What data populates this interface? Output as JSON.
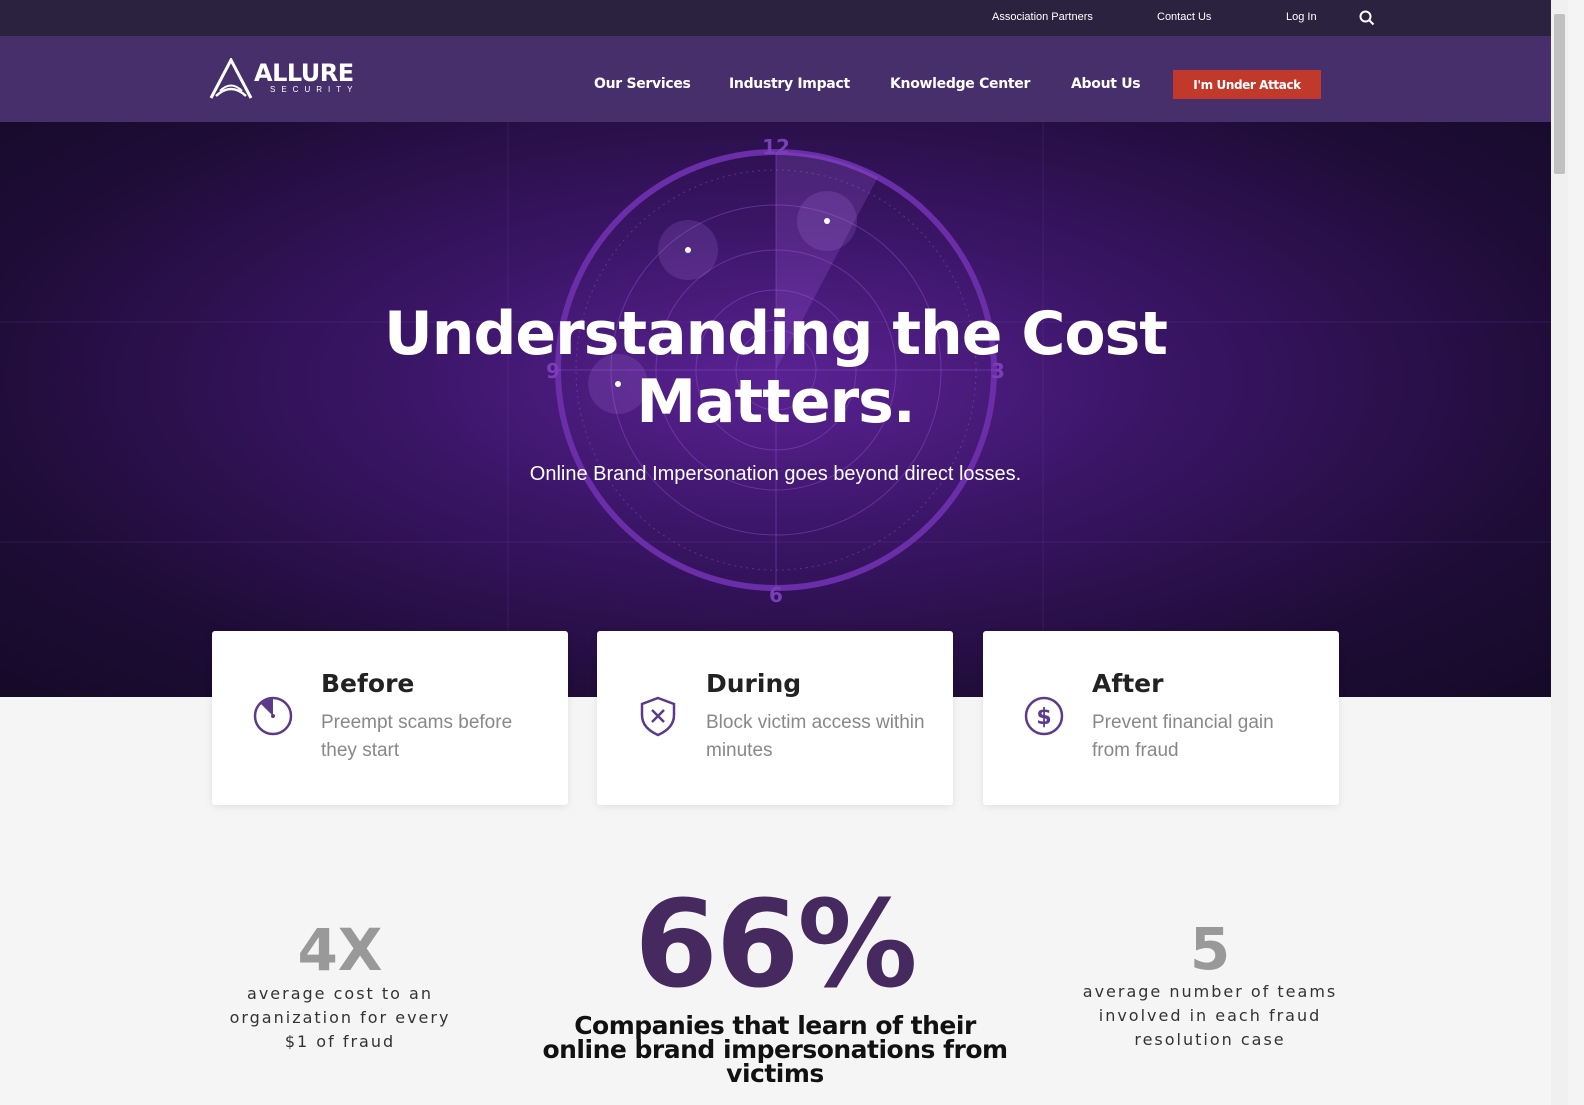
{
  "topbar": {
    "links": [
      "Association Partners",
      "Contact Us",
      "Log In"
    ],
    "search_icon": "search-icon"
  },
  "logo": {
    "name": "ALLURE",
    "sub": "SECURITY"
  },
  "nav": {
    "items": [
      "Our Services",
      "Industry Impact",
      "Knowledge Center",
      "About Us"
    ],
    "cta": "I'm Under Attack"
  },
  "colors": {
    "accent": "#472f6b",
    "cta": "#c0392b",
    "dark": "#2b2240"
  },
  "hero": {
    "title": "Understanding the Cost Matters.",
    "subtitle": "Online Brand Impersonation goes beyond direct losses.",
    "clock": [
      "12",
      "3",
      "6",
      "9"
    ]
  },
  "cards": [
    {
      "title": "Before",
      "text": "Preempt scams before they start",
      "icon": "clock-icon"
    },
    {
      "title": "During",
      "text": "Block victim access within minutes",
      "icon": "shield-x-icon"
    },
    {
      "title": "After",
      "text": "Prevent financial gain from fraud",
      "icon": "dollar-icon"
    }
  ],
  "stats": [
    {
      "value": "4X",
      "desc": "average cost to an organization for every $1 of fraud"
    },
    {
      "value": "66%",
      "desc": "Companies that learn of their online brand impersonations from victims"
    },
    {
      "value": "5",
      "desc": "average number of teams involved in each fraud resolution case"
    }
  ]
}
